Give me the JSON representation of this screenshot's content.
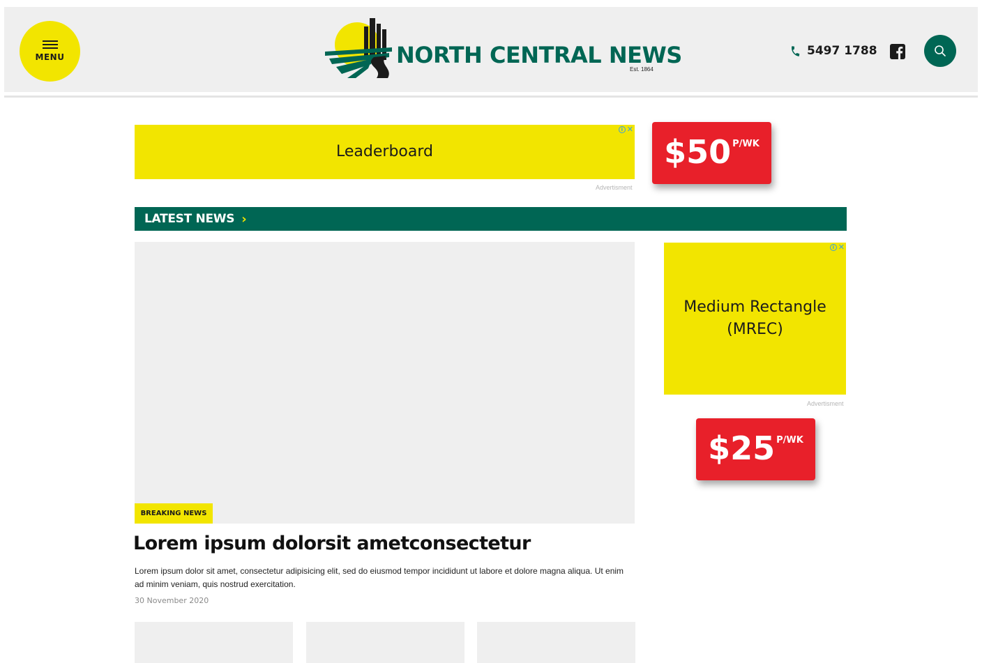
{
  "header": {
    "menu_label": "MENU",
    "logo_title": "NORTH CENTRAL NEWS",
    "logo_est": "Est. 1864",
    "phone": "5497 1788"
  },
  "colors": {
    "brand_green": "#006654",
    "brand_yellow": "#f2e500",
    "price_red": "#e8202a"
  },
  "ads": {
    "leaderboard": {
      "label": "Leaderboard",
      "caption": "Advertisment",
      "price": "$50",
      "per": "P/WK"
    },
    "mrec": {
      "label_line1": "Medium Rectangle",
      "label_line2": "(MREC)",
      "caption": "Advertisment",
      "price": "$25",
      "per": "P/WK"
    }
  },
  "latest_news": {
    "label": "LATEST NEWS",
    "chevron": "›"
  },
  "feature": {
    "badge": "BREAKING NEWS",
    "headline": "Lorem ipsum dolorsit ametconsectetur",
    "summary": "Lorem ipsum dolor sit amet, consectetur adipisicing elit, sed do eiusmod tempor incididunt ut labore et dolore magna aliqua. Ut enim ad minim veniam, quis nostrud exercitation.",
    "date": "30 November 2020"
  },
  "icons": {
    "menu": "hamburger-icon",
    "phone": "phone-icon",
    "facebook": "facebook-icon",
    "search": "search-icon",
    "adchoices": "adchoices-icon",
    "ad_close": "close-icon"
  }
}
